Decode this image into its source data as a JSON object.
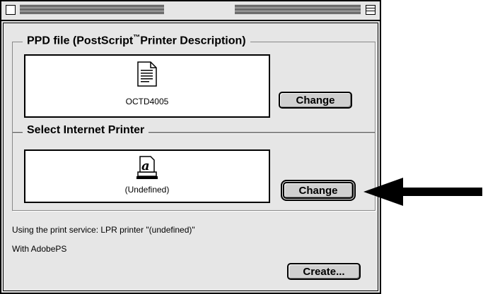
{
  "window": {
    "title": ""
  },
  "ppd_group": {
    "title_prefix": "PPD file (PostScript",
    "title_tm": "™",
    "title_suffix": "Printer Description)",
    "file_name": "OCTD4005",
    "change_label": "Change"
  },
  "printer_group": {
    "title": "Select Internet Printer",
    "printer_name": "(Undefined)",
    "change_label": "Change"
  },
  "status": {
    "service_line": "Using the print service: LPR printer \"(undefined)\"",
    "with_line": "With AdobePS"
  },
  "create_label": "Create...",
  "icons": {
    "ppd": "document-icon",
    "printer": "printer-icon",
    "pointer": "arrow-icon"
  }
}
